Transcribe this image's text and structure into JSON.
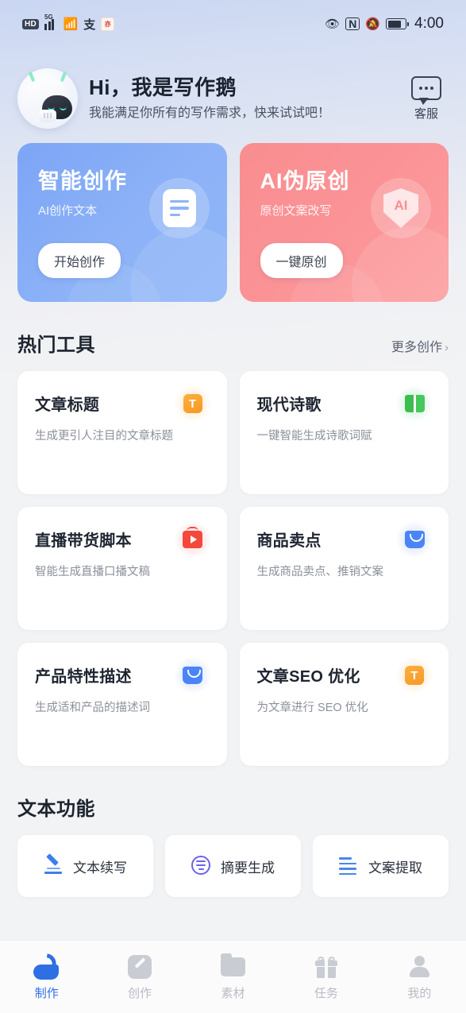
{
  "status_bar": {
    "hd_label": "HD",
    "network_label": "5G",
    "app_badge_label": "亦",
    "alipay_label": "支",
    "time": "4:00",
    "icons": [
      "hd-badge",
      "signal-5g-icon",
      "wifi-icon",
      "alipay-icon",
      "app-badge-icon",
      "eye-icon",
      "nfc-icon",
      "bell-muted-icon",
      "battery-icon"
    ]
  },
  "header": {
    "title": "Hi，我是写作鹅",
    "subtitle": "我能满足你所有的写作需求，快来试试吧！",
    "support_label": "客服"
  },
  "banners": [
    {
      "title": "智能创作",
      "subtitle": "AI创作文本",
      "button": "开始创作",
      "icon": "document-icon",
      "color": "#8db2f7"
    },
    {
      "title": "AI伪原创",
      "subtitle": "原创文案改写",
      "button": "一键原创",
      "icon": "shield-ai-icon",
      "icon_label": "AI",
      "color": "#fb9497"
    }
  ],
  "hot_tools": {
    "section_title": "热门工具",
    "more_label": "更多创作",
    "more_chevron": "›",
    "items": [
      {
        "title": "文章标题",
        "desc": "生成更引人注目的文章标题",
        "icon": "text-t-icon",
        "icon_text": "T",
        "accent": "#f79724"
      },
      {
        "title": "现代诗歌",
        "desc": "一键智能生成诗歌词赋",
        "icon": "book-icon",
        "accent": "#46c85a"
      },
      {
        "title": "直播带货脚本",
        "desc": "智能生成直播口播文稿",
        "icon": "tv-play-icon",
        "accent": "#f4483c"
      },
      {
        "title": "商品卖点",
        "desc": "生成商品卖点、推销文案",
        "icon": "shopping-bag-icon",
        "accent": "#4a84f7"
      },
      {
        "title": "产品特性描述",
        "desc": "生成适和产品的描述词",
        "icon": "shopping-bag-icon",
        "accent": "#4a84f7"
      },
      {
        "title": "文章SEO 优化",
        "desc": "为文章进行 SEO 优化",
        "icon": "text-t-icon",
        "icon_text": "T",
        "accent": "#f79724"
      }
    ]
  },
  "text_functions": {
    "section_title": "文本功能",
    "items": [
      {
        "label": "文本续写",
        "icon": "pen-write-icon"
      },
      {
        "label": "摘要生成",
        "icon": "summary-circle-icon"
      },
      {
        "label": "文案提取",
        "icon": "extract-list-icon"
      }
    ]
  },
  "tabbar": {
    "items": [
      {
        "label": "制作",
        "icon": "swan-icon",
        "active": true
      },
      {
        "label": "创作",
        "icon": "pencil-icon",
        "active": false
      },
      {
        "label": "素材",
        "icon": "folder-icon",
        "active": false
      },
      {
        "label": "任务",
        "icon": "gift-icon",
        "active": false
      },
      {
        "label": "我的",
        "icon": "user-icon",
        "active": false
      }
    ]
  }
}
